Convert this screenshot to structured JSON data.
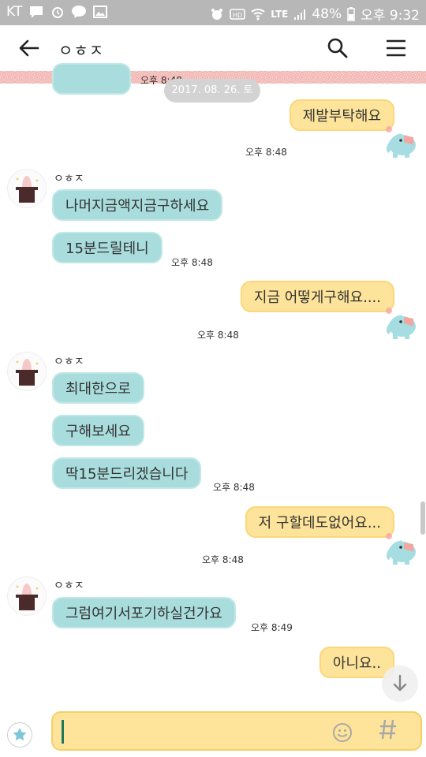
{
  "status_bar": {
    "carrier": "KT",
    "network": "LTE",
    "battery": "48%",
    "time": "오후 9:32"
  },
  "header": {
    "title": "ㅇㅎㅈ",
    "icons": [
      "back-arrow-icon",
      "search-icon",
      "menu-icon"
    ]
  },
  "chat": {
    "partial_time": "오후 8:48",
    "date": "2017. 08. 26. 토",
    "sender_name": "ㅇㅎㅈ",
    "messages": [
      {
        "side": "right",
        "text": "제발부탁해요"
      },
      {
        "side": "right-time",
        "text": "오후 8:48"
      },
      {
        "side": "left",
        "text": "나머지금액지금구하세요"
      },
      {
        "side": "left",
        "text": "15분드릴테니"
      },
      {
        "side": "left-time",
        "text": "오후 8:48"
      },
      {
        "side": "right",
        "text": "지금 어떻게구해요...."
      },
      {
        "side": "right-time",
        "text": "오후 8:48"
      },
      {
        "side": "left",
        "text": "최대한으로"
      },
      {
        "side": "left",
        "text": "구해보세요"
      },
      {
        "side": "left",
        "text": "딱15분드리겠습니다"
      },
      {
        "side": "left-time",
        "text": "오후 8:48"
      },
      {
        "side": "right",
        "text": "저 구할데도없어요..."
      },
      {
        "side": "right-time",
        "text": "오후 8:48"
      },
      {
        "side": "left",
        "text": "그럼여기서포기하실건가요"
      },
      {
        "side": "left-time",
        "text": "오후 8:49"
      },
      {
        "side": "right",
        "text": "아니요.."
      }
    ]
  },
  "input": {
    "value": "",
    "icons": [
      "emoticon-star-icon",
      "smile-icon",
      "hash-icon"
    ]
  },
  "colors": {
    "status_bar": "#b7b7b7",
    "left_bubble": "#a9dcdc",
    "right_bubble": "#fde49a",
    "input_box": "#fde49a",
    "cursor": "#1b7a5c"
  }
}
